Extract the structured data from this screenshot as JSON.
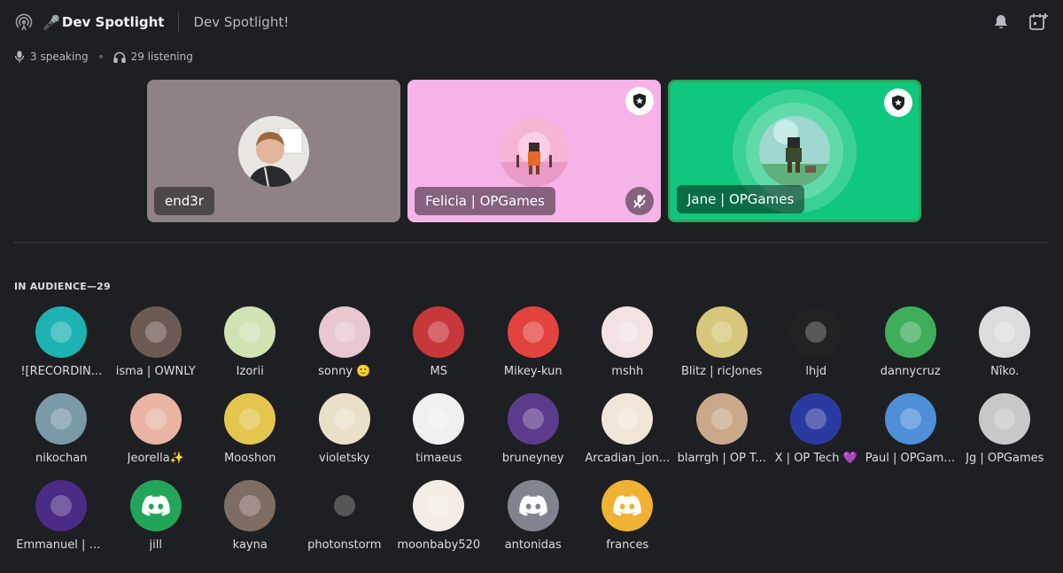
{
  "header": {
    "channel_emoji": "🎤",
    "channel_name": "Dev Spotlight",
    "topic": "Dev Spotlight!"
  },
  "stats": {
    "speaking": "3 speaking",
    "listening": "29 listening"
  },
  "speakers": [
    {
      "name": "end3r",
      "bg": "#8e8286",
      "badge": false,
      "muted": false
    },
    {
      "name": "Felicia | OPGames",
      "bg": "#f5b3e8",
      "badge": true,
      "muted": true
    },
    {
      "name": "Jane | OPGames",
      "bg": "#0fc77e",
      "badge": true,
      "muted": false,
      "speaking": true
    }
  ],
  "audience": {
    "header": "IN AUDIENCE—29",
    "members": [
      {
        "name": "![RECORDIN...",
        "color": "#1eb3b3"
      },
      {
        "name": "isma | OWNLY",
        "color": "#6b5b53"
      },
      {
        "name": "Izorii",
        "color": "#cfe3b3"
      },
      {
        "name": "sonny 🙂",
        "color": "#e8c7d0"
      },
      {
        "name": "MS",
        "color": "#c8373a"
      },
      {
        "name": "Mikey-kun",
        "color": "#e2433f"
      },
      {
        "name": "mshh",
        "color": "#f2e2e4"
      },
      {
        "name": "Blitz | ricJones",
        "color": "#d6c77a"
      },
      {
        "name": "lhjd",
        "color": "#222222"
      },
      {
        "name": "dannycruz",
        "color": "#3fae5a"
      },
      {
        "name": "Nîko.",
        "color": "#dcdcdc"
      },
      {
        "name": "nikochan",
        "color": "#7a9aa8"
      },
      {
        "name": "Jeorella✨",
        "color": "#e9b4a4"
      },
      {
        "name": "Mooshon",
        "color": "#e4c54d"
      },
      {
        "name": "violetsky",
        "color": "#e8e0c8"
      },
      {
        "name": "timaeus",
        "color": "#f0f0f0"
      },
      {
        "name": "bruneyney",
        "color": "#5b3c8c"
      },
      {
        "name": "Arcadian_jon...",
        "color": "#f2e6d8"
      },
      {
        "name": "blarrgh | OP T...",
        "color": "#caa98a"
      },
      {
        "name": "X | OP Tech 💜",
        "color": "#2b3aa0"
      },
      {
        "name": "Paul | OPGames",
        "color": "#4f8fd8"
      },
      {
        "name": "Jg | OPGames",
        "color": "#c8c8c8"
      },
      {
        "name": "Emmanuel | O...",
        "color": "#4a2b86"
      },
      {
        "name": "jill",
        "color": "#23a559",
        "discord": true
      },
      {
        "name": "kayna",
        "color": "#7d6d63"
      },
      {
        "name": "photonstorm",
        "color": "#1e1f22"
      },
      {
        "name": "moonbaby520",
        "color": "#f4ede6"
      },
      {
        "name": "antonidas",
        "color": "#80848e",
        "discord": true
      },
      {
        "name": "frances",
        "color": "#f0b232",
        "discord": true
      }
    ]
  },
  "icons": {
    "stage": "stage-channel-icon",
    "bell": "bell-icon",
    "calendar": "calendar-add-icon",
    "mic": "mic-icon",
    "headphones": "headphones-icon",
    "badge": "moderator-shield-icon",
    "mute": "mic-muted-icon",
    "discord": "discord-logo-icon"
  }
}
